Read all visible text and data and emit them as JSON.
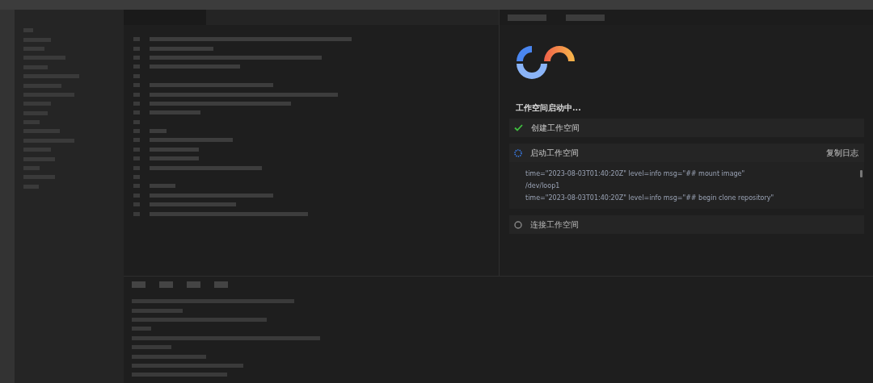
{
  "workspace_panel": {
    "title": "工作空间启动中...",
    "steps": [
      {
        "label": "创建工作空间",
        "kind": "done"
      },
      {
        "label": "启动工作空间",
        "kind": "running",
        "action": "复制日志",
        "log": [
          "time=\"2023-08-03T01:40:20Z\" level=info msg=\"## mount image\"",
          "/dev/loop1",
          "time=\"2023-08-03T01:40:20Z\" level=info msg=\"## begin clone repository\""
        ]
      },
      {
        "label": "连接工作空间",
        "kind": "pending"
      }
    ]
  }
}
